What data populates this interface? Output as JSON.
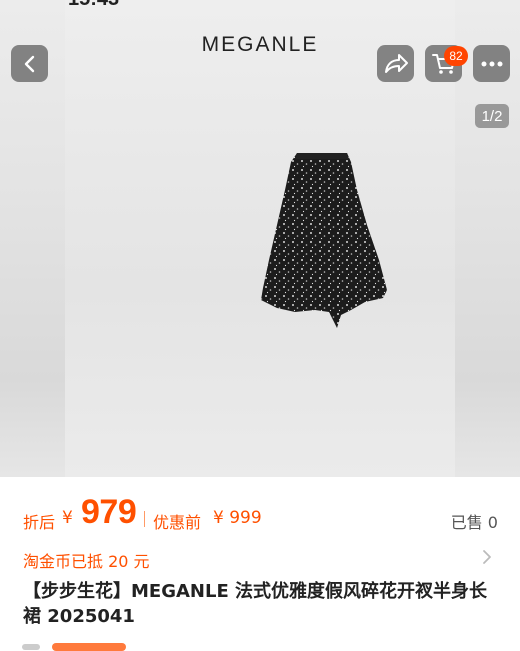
{
  "status_bar": {
    "time": "15:43"
  },
  "hero": {
    "brand": "MEGANLE",
    "cart_badge": "82",
    "page_indicator": "1/2",
    "icons": {
      "back": "chevron-left-icon",
      "share": "share-icon",
      "cart": "cart-icon",
      "more": "more-icon"
    }
  },
  "pricing": {
    "discount_label": "折后",
    "currency": "¥",
    "price": "979",
    "original_label": "优惠前",
    "original_price": "¥ 999",
    "sold": "已售 0",
    "accent_color": "#ff5000"
  },
  "coins": {
    "text": "淘金币已抵 20 元"
  },
  "product": {
    "title": "【步步生花】MEGANLE 法式优雅度假风碎花开衩半身长裙 2025041"
  }
}
